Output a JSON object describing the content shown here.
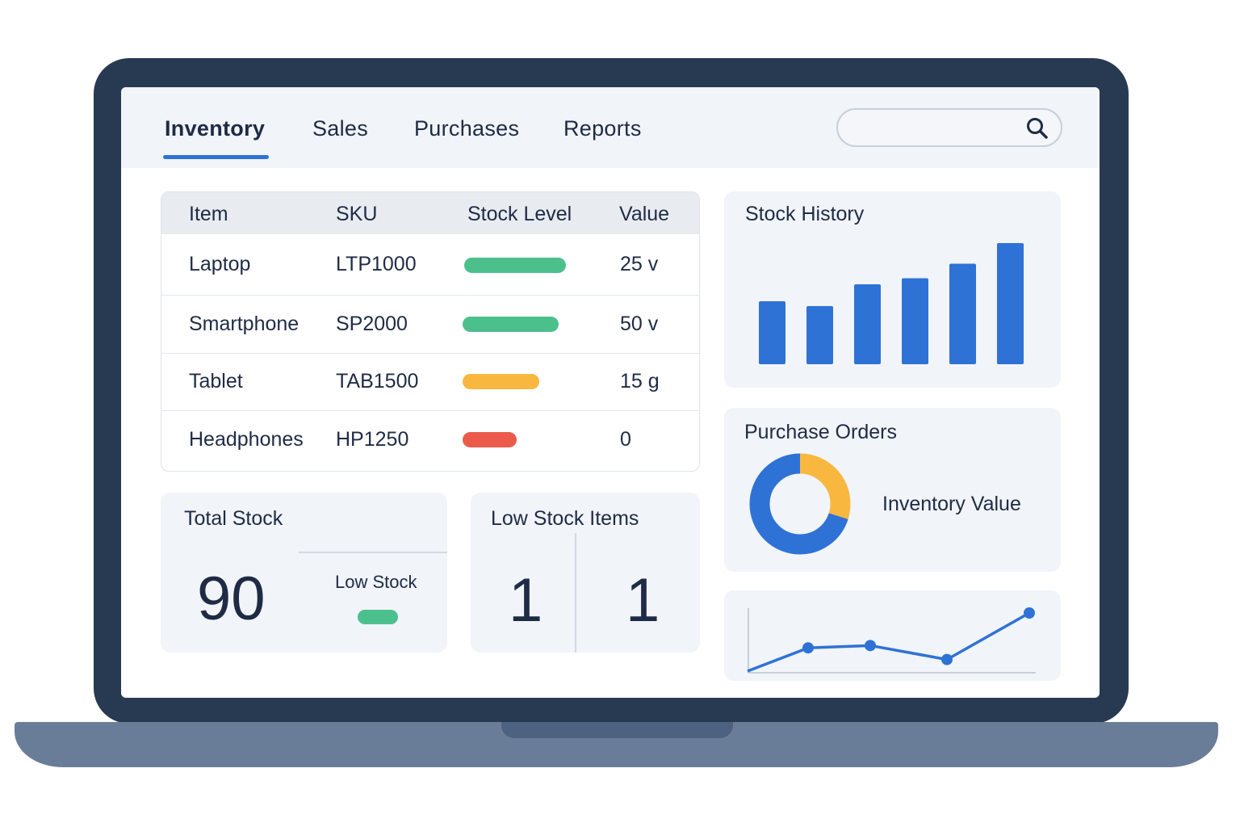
{
  "nav": {
    "tabs": [
      {
        "label": "Inventory",
        "active": true
      },
      {
        "label": "Sales",
        "active": false
      },
      {
        "label": "Purchases",
        "active": false
      },
      {
        "label": "Reports",
        "active": false
      }
    ],
    "search": {
      "placeholder": "",
      "icon": "search-icon"
    }
  },
  "inventory_table": {
    "headers": [
      "Item",
      "SKU",
      "Stock Level",
      "Value"
    ],
    "rows": [
      {
        "item": "Laptop",
        "sku": "LTP1000",
        "stock_level": 0.9,
        "stock_status": "ok",
        "stock_color": "#4cc08c",
        "value": "25 v"
      },
      {
        "item": "Smartphone",
        "sku": "SP2000",
        "stock_level": 0.85,
        "stock_status": "ok",
        "stock_color": "#4cc08c",
        "value": "50 v"
      },
      {
        "item": "Tablet",
        "sku": "TAB1500",
        "stock_level": 0.68,
        "stock_status": "medium",
        "stock_color": "#f8b73e",
        "value": "15 g"
      },
      {
        "item": "Headphones",
        "sku": "HP1250",
        "stock_level": 0.48,
        "stock_status": "low",
        "stock_color": "#eb5a4b",
        "value": "0"
      }
    ]
  },
  "total_stock": {
    "title": "Total Stock",
    "value": "90",
    "sub_label": "Low Stock",
    "indicator_color": "#4cc08c"
  },
  "low_stock_items": {
    "title": "Low Stock Items",
    "values": [
      "1",
      "1"
    ]
  },
  "stock_history": {
    "title": "Stock History",
    "chart_data": {
      "type": "bar",
      "values": [
        52,
        48,
        66,
        71,
        83,
        100
      ],
      "color": "#2f72d6",
      "ylim": [
        0,
        100
      ],
      "grid": false
    }
  },
  "purchase_orders": {
    "title": "Purchase Orders",
    "label": "Inventory Value",
    "chart_data": {
      "type": "pie",
      "donut": true,
      "values": [
        0.7,
        0.3
      ],
      "colors": [
        "#2f72d6",
        "#f8b73e"
      ]
    }
  },
  "trend_chart": {
    "chart_data": {
      "type": "line",
      "values": [
        0,
        40,
        44,
        20,
        100
      ],
      "ylim": [
        0,
        100
      ],
      "color": "#2f72d6",
      "markers": [
        false,
        true,
        true,
        true,
        true
      ]
    }
  },
  "colors": {
    "accent": "#2f72d6",
    "bezel": "#283a52",
    "card_bg": "#f1f4f8"
  }
}
